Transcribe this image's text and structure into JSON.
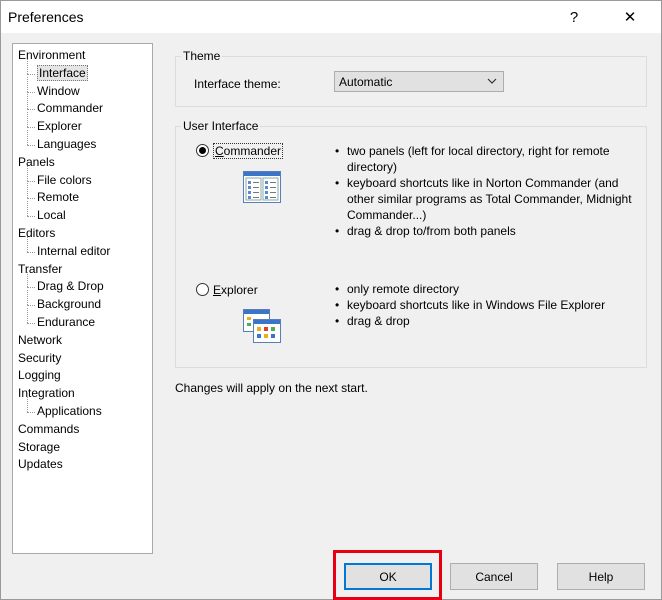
{
  "window": {
    "title": "Preferences",
    "help_glyph": "?",
    "close_glyph": "✕"
  },
  "tree": [
    {
      "label": "Environment",
      "level": 0
    },
    {
      "label": "Interface",
      "level": 1,
      "selected": true
    },
    {
      "label": "Window",
      "level": 1
    },
    {
      "label": "Commander",
      "level": 1
    },
    {
      "label": "Explorer",
      "level": 1
    },
    {
      "label": "Languages",
      "level": 1
    },
    {
      "label": "Panels",
      "level": 0
    },
    {
      "label": "File colors",
      "level": 1
    },
    {
      "label": "Remote",
      "level": 1
    },
    {
      "label": "Local",
      "level": 1
    },
    {
      "label": "Editors",
      "level": 0
    },
    {
      "label": "Internal editor",
      "level": 1
    },
    {
      "label": "Transfer",
      "level": 0
    },
    {
      "label": "Drag & Drop",
      "level": 1
    },
    {
      "label": "Background",
      "level": 1
    },
    {
      "label": "Endurance",
      "level": 1
    },
    {
      "label": "Network",
      "level": 0
    },
    {
      "label": "Security",
      "level": 0
    },
    {
      "label": "Logging",
      "level": 0
    },
    {
      "label": "Integration",
      "level": 0
    },
    {
      "label": "Applications",
      "level": 1
    },
    {
      "label": "Commands",
      "level": 0
    },
    {
      "label": "Storage",
      "level": 0
    },
    {
      "label": "Updates",
      "level": 0
    }
  ],
  "theme": {
    "legend": "Theme",
    "label": "Interface theme:",
    "value": "Automatic"
  },
  "ui": {
    "legend": "User Interface",
    "commander": {
      "label": "Commander",
      "accel": "C",
      "rest": "ommander",
      "checked": true,
      "bullets": [
        "two panels (left for local directory, right for remote directory)",
        "keyboard shortcuts like in Norton Commander (and other similar programs as Total Commander, Midnight Commander...)",
        "drag & drop to/from both panels"
      ]
    },
    "explorer": {
      "label": "Explorer",
      "accel": "E",
      "rest": "xplorer",
      "checked": false,
      "bullets": [
        "only remote directory",
        "keyboard shortcuts like in Windows File Explorer",
        "drag & drop"
      ]
    }
  },
  "note": "Changes will apply on the next start.",
  "buttons": {
    "ok": "OK",
    "cancel": "Cancel",
    "help": "Help"
  },
  "colors": {
    "highlight": "#e60012",
    "focus": "#0078d7"
  }
}
